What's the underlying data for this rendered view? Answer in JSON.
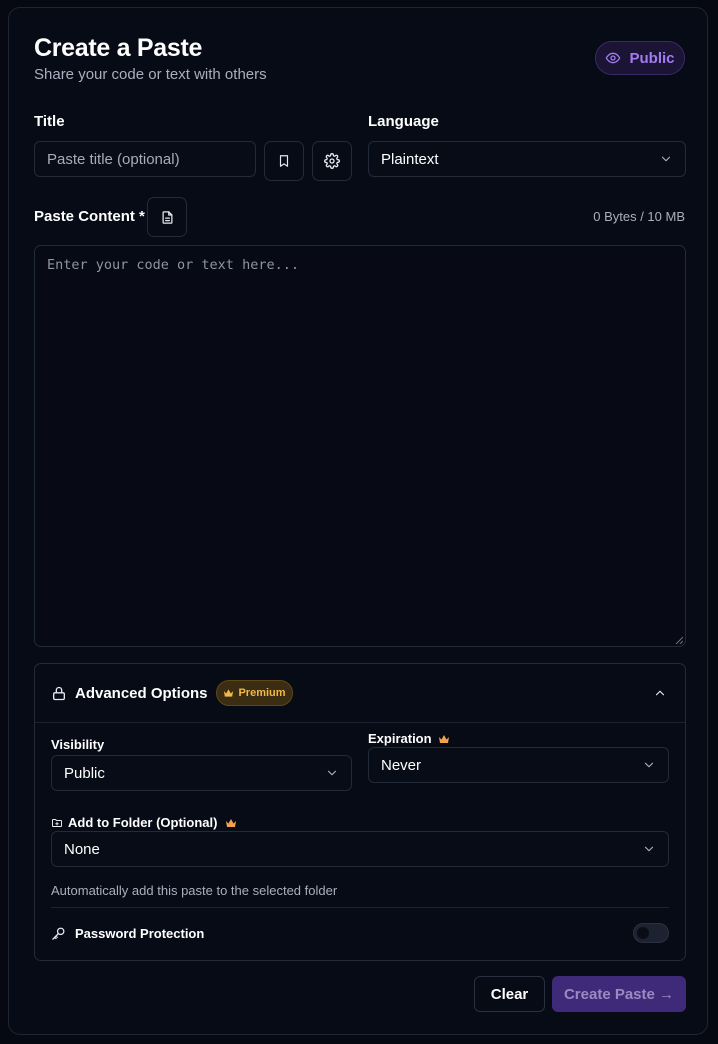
{
  "header": {
    "title": "Create a Paste",
    "subtitle": "Share your code or text with others",
    "visibility_badge": "Public"
  },
  "title_field": {
    "label": "Title",
    "placeholder": "Paste title (optional)"
  },
  "language_field": {
    "label": "Language",
    "value": "Plaintext"
  },
  "content": {
    "label": "Paste Content *",
    "size_indicator": "0 Bytes / 10 MB",
    "placeholder": "Enter your code or text here..."
  },
  "advanced": {
    "title": "Advanced Options",
    "premium_badge": "Premium",
    "visibility_label": "Visibility",
    "visibility_value": "Public",
    "expiration_label": "Expiration",
    "expiration_value": "Never",
    "folder_label": "Add to Folder (Optional)",
    "folder_value": "None",
    "folder_hint": "Automatically add this paste to the selected folder",
    "password_label": "Password Protection",
    "password_enabled": false
  },
  "actions": {
    "clear_label": "Clear",
    "create_label": "Create Paste →"
  },
  "colors": {
    "accent_purple": "#a27cf0",
    "premium_gold": "#f2b84b",
    "create_button_bg": "#3f2a7a"
  }
}
